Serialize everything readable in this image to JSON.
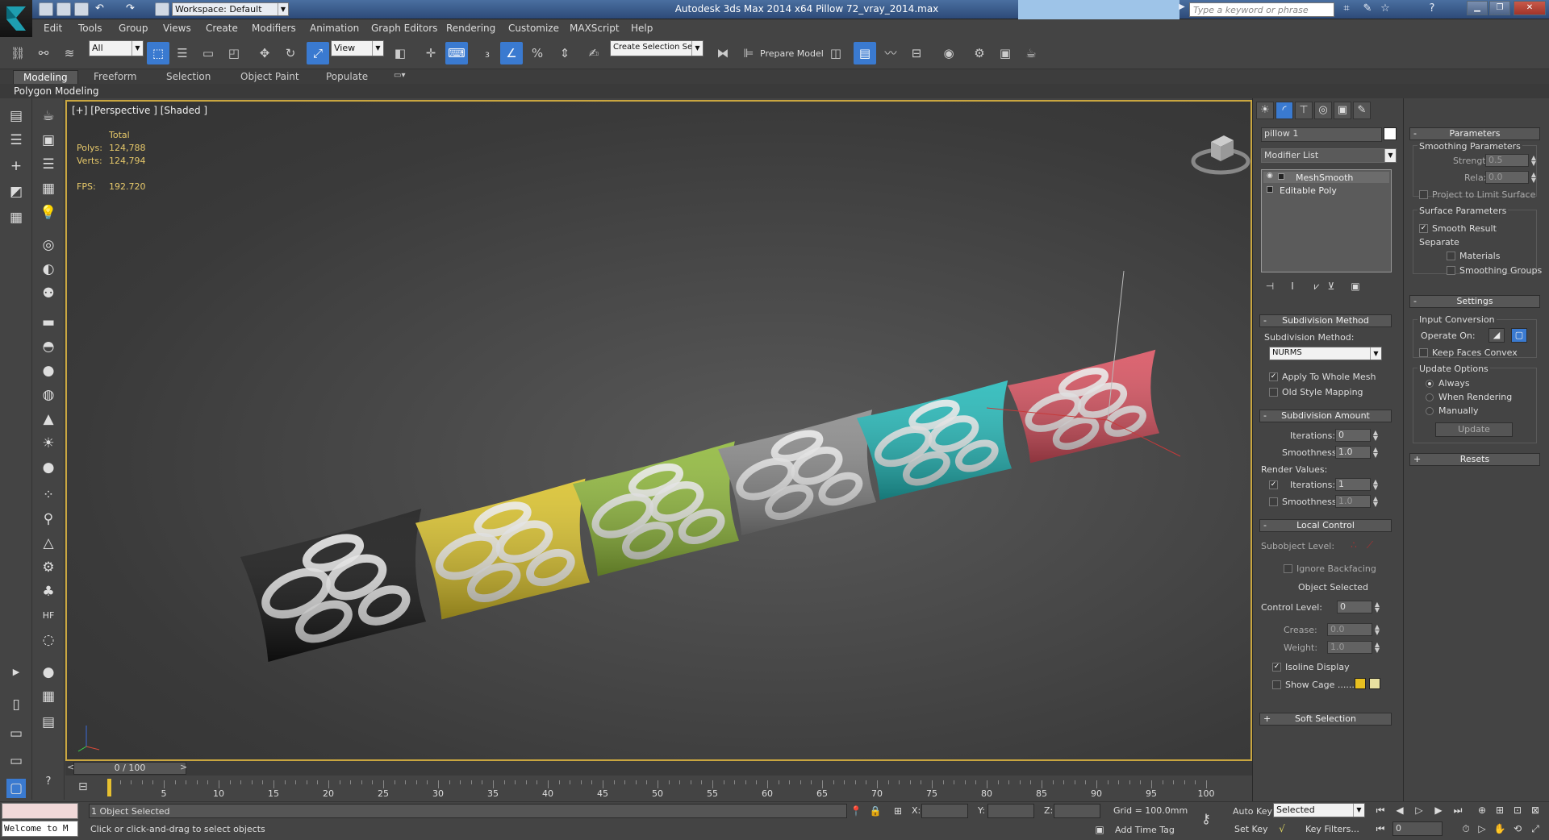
{
  "titlebar": {
    "workspace": "Workspace: Default",
    "app_title": "Autodesk 3ds Max  2014 x64      Pillow 72_vray_2014.max",
    "search_placeholder": "Type a keyword or phrase"
  },
  "menu": [
    "Edit",
    "Tools",
    "Group",
    "Views",
    "Create",
    "Modifiers",
    "Animation",
    "Graph Editors",
    "Rendering",
    "Customize",
    "MAXScript",
    "Help"
  ],
  "toolbar": {
    "selection_filter": "All",
    "ref_coord": "View",
    "named_selection": "Create Selection Se",
    "prepare_model": "Prepare Model"
  },
  "ribbon": {
    "tabs": [
      "Modeling",
      "Freeform",
      "Selection",
      "Object Paint",
      "Populate"
    ],
    "active": "Modeling",
    "panel_title": "Polygon Modeling"
  },
  "viewport": {
    "label": "[+] [Perspective ] [Shaded ]",
    "stats": {
      "total_label": "Total",
      "polys_label": "Polys:",
      "polys": "124,788",
      "verts_label": "Verts:",
      "verts": "124,794",
      "fps_label": "FPS:",
      "fps": "192.720"
    },
    "pillows": [
      {
        "name": "black",
        "color": "#141414"
      },
      {
        "name": "yellow",
        "color": "#d9c12a"
      },
      {
        "name": "green",
        "color": "#8fb83a"
      },
      {
        "name": "grey",
        "color": "#8a8a8a"
      },
      {
        "name": "teal",
        "color": "#22b8b8"
      },
      {
        "name": "red",
        "color": "#d8505e"
      }
    ]
  },
  "timeline": {
    "slider": "0 / 100",
    "ticks": [
      "5",
      "10",
      "15",
      "20",
      "25",
      "30",
      "35",
      "40",
      "45",
      "50",
      "55",
      "60",
      "65",
      "70",
      "75",
      "80",
      "85",
      "90",
      "95",
      "100"
    ]
  },
  "status": {
    "maxscript": "Welcome to M",
    "selection_info": "1 Object Selected",
    "prompt": "Click or click-and-drag to select objects",
    "x_label": "X:",
    "y_label": "Y:",
    "z_label": "Z:",
    "grid": "Grid = 100.0mm",
    "auto_key": "Auto Key",
    "set_key": "Set Key",
    "key_mode": "Selected",
    "key_filters": "Key Filters...",
    "add_time_tag": "Add Time Tag",
    "frame": "0"
  },
  "command_panel": {
    "object_name": "pillow 1",
    "modifier_list": "Modifier List",
    "stack": [
      "MeshSmooth",
      "Editable Poly"
    ],
    "subdivision_method": {
      "title": "Subdivision Method",
      "label": "Subdivision Method:",
      "value": "NURMS",
      "apply_whole": "Apply To Whole Mesh",
      "old_style": "Old Style Mapping"
    },
    "subdivision_amount": {
      "title": "Subdivision Amount",
      "iterations_label": "Iterations:",
      "iterations": "0",
      "smoothness_label": "Smoothness:",
      "smoothness": "1.0",
      "render_values": "Render Values:",
      "r_iterations_label": "Iterations:",
      "r_iterations": "1",
      "r_smoothness_label": "Smoothness:",
      "r_smoothness": "1.0"
    },
    "local_control": {
      "title": "Local Control",
      "subobject": "Subobject Level:",
      "ignore_backfacing": "Ignore Backfacing",
      "object_selected": "Object Selected",
      "control_level_label": "Control Level:",
      "control_level": "0",
      "crease_label": "Crease:",
      "crease": "0.0",
      "weight_label": "Weight:",
      "weight": "1.0",
      "isoline": "Isoline Display",
      "show_cage": "Show Cage ......",
      "cage_color1": "#e8c020",
      "cage_color2": "#e8e0a0"
    },
    "soft_selection": "Soft Selection",
    "parameters": {
      "title": "Parameters",
      "smoothing_params": "Smoothing Parameters",
      "strength_label": "Strength:",
      "strength": "0.5",
      "relax_label": "Relax:",
      "relax": "0.0",
      "project_limit": "Project to Limit Surface",
      "surface_params": "Surface Parameters",
      "smooth_result": "Smooth Result",
      "separate": "Separate",
      "materials": "Materials",
      "smoothing_groups": "Smoothing Groups"
    },
    "settings": {
      "title": "Settings",
      "input_conversion": "Input Conversion",
      "operate_on": "Operate On:",
      "keep_faces": "Keep Faces Convex",
      "update_options": "Update Options",
      "always": "Always",
      "when_rendering": "When Rendering",
      "manually": "Manually",
      "update": "Update"
    },
    "resets": "Resets"
  },
  "colors": {
    "accent": "#3a7ad0",
    "viewport_border": "#c9a640",
    "stats_text": "#e6c86a"
  }
}
